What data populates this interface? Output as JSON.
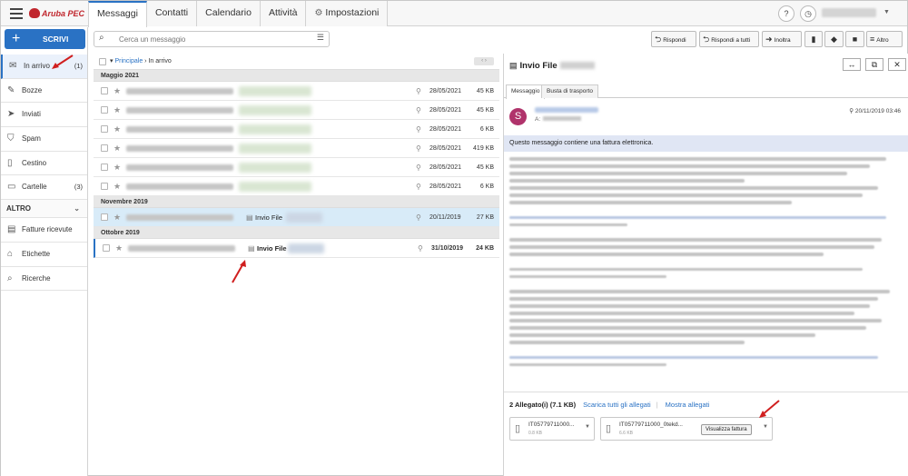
{
  "app": {
    "logo": "Aruba PEC",
    "user": "conto_utente"
  },
  "tabs": [
    {
      "label": "Messaggi"
    },
    {
      "label": "Contatti"
    },
    {
      "label": "Calendario"
    },
    {
      "label": "Attività"
    },
    {
      "label": "Impostazioni"
    }
  ],
  "compose": {
    "label": "SCRIVI"
  },
  "nav": [
    {
      "label": "In arrivo",
      "count": "(1)",
      "icon": "inbox-icon"
    },
    {
      "label": "Bozze",
      "count": "",
      "icon": "draft-icon"
    },
    {
      "label": "Inviati",
      "count": "",
      "icon": "send-icon"
    },
    {
      "label": "Spam",
      "count": "",
      "icon": "shield-icon"
    },
    {
      "label": "Cestino",
      "count": "",
      "icon": "trash-icon"
    },
    {
      "label": "Cartelle",
      "count": "(3)",
      "icon": "folder-icon"
    }
  ],
  "altro": {
    "label": "ALTRO"
  },
  "altro_items": [
    {
      "label": "Fatture ricevute",
      "icon": "invoice-icon"
    },
    {
      "label": "Etichette",
      "icon": "tag-icon"
    },
    {
      "label": "Ricerche",
      "icon": "search-icon"
    }
  ],
  "search": {
    "placeholder": "Cerca un messaggio"
  },
  "actions": {
    "reply": "Rispondi",
    "reply_all": "Rispondi a tutti",
    "forward": "Inoltra",
    "more": "Altro"
  },
  "breadcrumb": {
    "root": "Principale",
    "sep": "›",
    "current": "In arrivo"
  },
  "groups": [
    {
      "label": "Maggio 2021",
      "rows": [
        {
          "date": "28/05/2021",
          "size": "45 KB"
        },
        {
          "date": "28/05/2021",
          "size": "45 KB"
        },
        {
          "date": "28/05/2021",
          "size": "6 KB"
        },
        {
          "date": "28/05/2021",
          "size": "419 KB"
        },
        {
          "date": "28/05/2021",
          "size": "45 KB"
        },
        {
          "date": "28/05/2021",
          "size": "6 KB"
        }
      ]
    },
    {
      "label": "Novembre 2019",
      "rows": [
        {
          "subject": "Invio File",
          "date": "20/11/2019",
          "size": "27 KB"
        }
      ]
    },
    {
      "label": "Ottobre 2019",
      "rows": [
        {
          "subject": "Invio File",
          "date": "31/10/2019",
          "size": "24 KB"
        }
      ]
    }
  ],
  "message": {
    "title": "Invio File",
    "tab_message": "Messaggio",
    "tab_envelope": "Busta di trasporto",
    "avatar_letter": "S",
    "to_label": "A:",
    "date": "20/11/2019 03:46",
    "notice": "Questo messaggio contiene una fattura elettronica."
  },
  "attachments": {
    "header": "2 Allegato(i) (7.1 KB)",
    "download_all": "Scarica tutti gli allegati",
    "show_all": "Mostra allegati",
    "items": [
      {
        "name": "IT05779711000...",
        "size": "0.8 KB"
      },
      {
        "name": "IT05779711000_0tekd...",
        "size": "6.6 KB",
        "action": "Visualizza fattura"
      }
    ]
  }
}
